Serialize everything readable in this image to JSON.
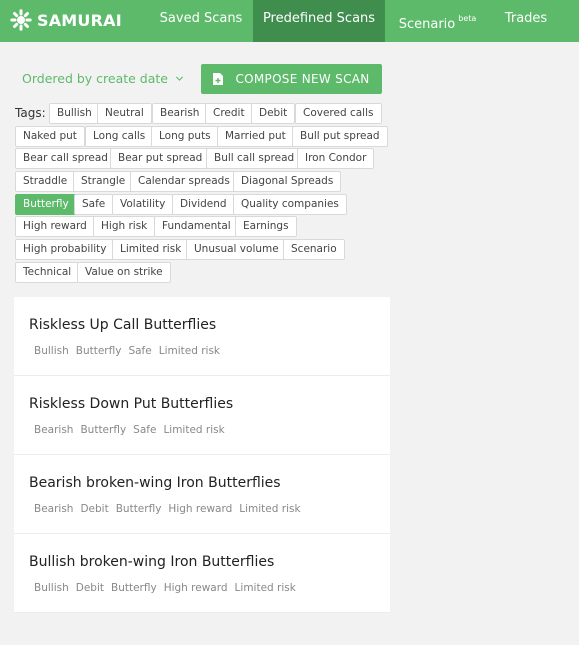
{
  "brand": {
    "name": "SAMURAI",
    "accent": "#5dba6b",
    "accent_dark": "#3f8e4e"
  },
  "nav": {
    "saved_scans": "Saved Scans",
    "predefined_scans": "Predefined Scans",
    "scenario": "Scenario",
    "scenario_badge": "beta",
    "trades": "Trades",
    "active": "Predefined Scans"
  },
  "toolbar": {
    "order_label": "Ordered by create date",
    "order_icon": "chevron-down-icon",
    "compose_label": "COMPOSE NEW SCAN",
    "compose_icon": "document-plus-icon"
  },
  "tags": {
    "label": "Tags:",
    "active": "Butterfly",
    "items": [
      "Bullish",
      "Neutral",
      "Bearish",
      "Credit",
      "Debit",
      "Covered calls",
      "Naked put",
      "Long calls",
      "Long puts",
      "Married put",
      "Bull put spread",
      "Bear call spread",
      "Bear put spread",
      "Bull call spread",
      "Iron Condor",
      "Straddle",
      "Strangle",
      "Calendar spreads",
      "Diagonal Spreads",
      "Butterfly",
      "Safe",
      "Volatility",
      "Dividend",
      "Quality companies",
      "High reward",
      "High risk",
      "Fundamental",
      "Earnings",
      "High probability",
      "Limited risk",
      "Unusual volume",
      "Scenario",
      "Technical",
      "Value on strike"
    ]
  },
  "scans": [
    {
      "title": "Riskless Up Call Butterflies",
      "tags": [
        "Bullish",
        "Butterfly",
        "Safe",
        "Limited risk"
      ]
    },
    {
      "title": "Riskless Down Put Butterflies",
      "tags": [
        "Bearish",
        "Butterfly",
        "Safe",
        "Limited risk"
      ]
    },
    {
      "title": "Bearish broken-wing Iron Butterflies",
      "tags": [
        "Bearish",
        "Debit",
        "Butterfly",
        "High reward",
        "Limited risk"
      ]
    },
    {
      "title": "Bullish broken-wing Iron Butterflies",
      "tags": [
        "Bullish",
        "Debit",
        "Butterfly",
        "High reward",
        "Limited risk"
      ]
    }
  ]
}
